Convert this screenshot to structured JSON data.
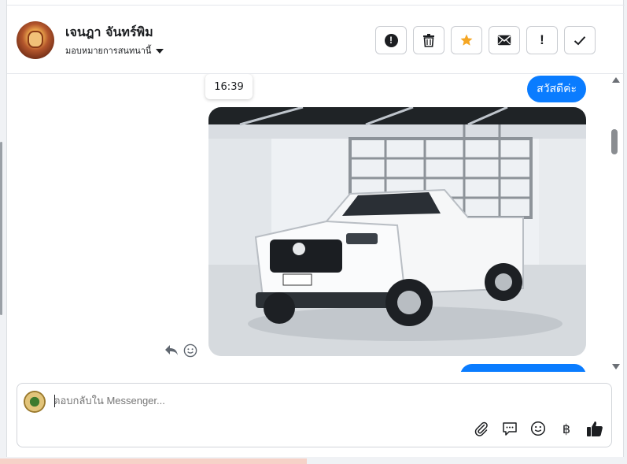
{
  "header": {
    "contact_name": "เจนฎา จันทร์พิม",
    "assign_label": "มอบหมายการสนทนานี้"
  },
  "toolbar": {
    "buttons": [
      "spam",
      "delete",
      "star",
      "mark-unread",
      "priority",
      "done"
    ],
    "star_color": "#f5a623"
  },
  "chat": {
    "timestamp": "16:39",
    "outgoing_greeting": "สวัสดีค่ะ",
    "bubble_color": "#0a7cff"
  },
  "composer": {
    "placeholder": "ตอบกลับใน Messenger..."
  }
}
